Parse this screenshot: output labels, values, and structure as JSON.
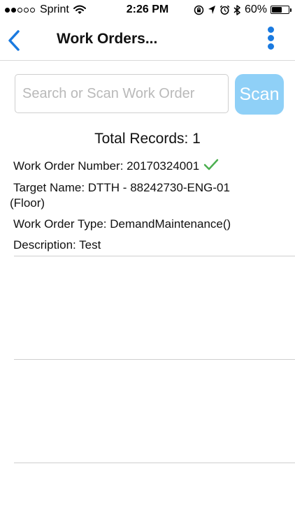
{
  "status_bar": {
    "carrier": "Sprint",
    "time": "2:26 PM",
    "battery_percent": "60%",
    "battery_level": 0.6,
    "signal_bars_filled": 2,
    "signal_bars_total": 5,
    "icons": [
      "wifi-icon",
      "rotation-lock-icon",
      "location-arrow-icon",
      "alarm-icon",
      "bluetooth-icon",
      "battery-icon"
    ]
  },
  "nav": {
    "title": "Work Orders...",
    "back_icon": "chevron-left-icon",
    "menu_icon": "more-vertical-icon"
  },
  "search": {
    "placeholder": "Search or Scan Work Order",
    "value": "",
    "scan_label": "Scan"
  },
  "results": {
    "total_label": "Total Records: 1"
  },
  "record": {
    "work_order_number": "Work Order Number: 20170324001",
    "target_name_line1": "Target Name: DTTH - 88242730-ENG-01",
    "target_name_line2": "(Floor)",
    "work_order_type": "Work Order Type: DemandMaintenance()",
    "description": "Description: Test",
    "status_icon": "checkmark-icon"
  },
  "colors": {
    "accent": "#1a7ae0",
    "scan_button": "#8fd0f7",
    "check": "#4caf50"
  }
}
